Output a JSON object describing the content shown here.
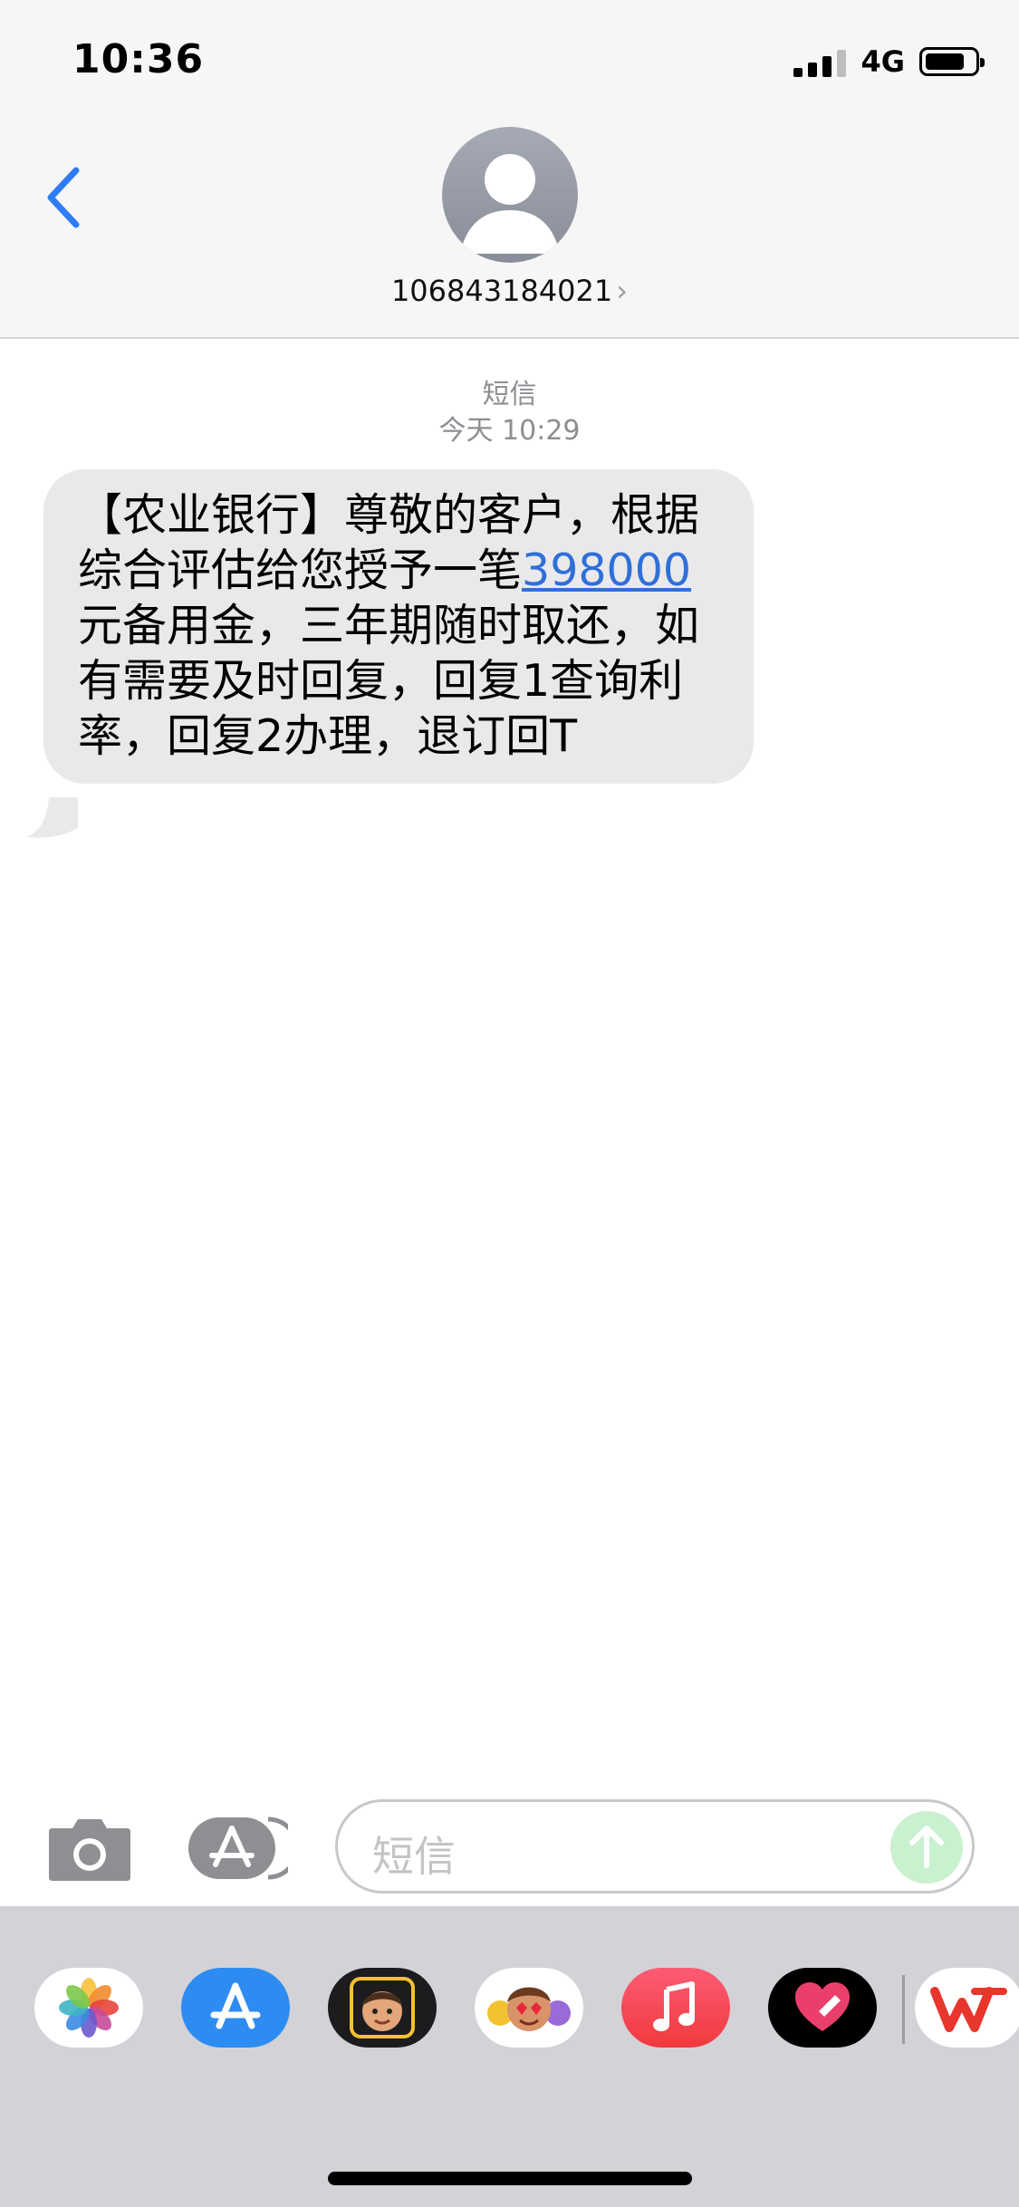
{
  "status_bar": {
    "time": "10:36",
    "network": "4G"
  },
  "header": {
    "contact": "106843184021",
    "contact_chevron": "›",
    "back_icon": "chevron-left-icon",
    "avatar_icon": "person-silhouette-icon"
  },
  "conversation": {
    "service_label": "短信",
    "timestamp": "今天 10:29",
    "message": {
      "before_link": "【农业银行】尊敬的客户，根据综合评估给您授予一笔",
      "link_text": "398000",
      "after_link": "元备用金，三年期随时取还，如有需要及时回复，回复1查询利率，回复2办理，退订回T"
    }
  },
  "compose": {
    "placeholder": "短信",
    "camera_icon": "camera-icon",
    "apps_icon": "app-store-icon",
    "send_icon": "arrow-up-icon"
  },
  "app_drawer": {
    "apps": [
      {
        "name": "photos-icon"
      },
      {
        "name": "app-store-icon"
      },
      {
        "name": "memoji-icon"
      },
      {
        "name": "animoji-stickers-icon"
      },
      {
        "name": "music-icon"
      },
      {
        "name": "digital-touch-icon"
      },
      {
        "name": "wps-office-icon"
      }
    ]
  },
  "colors": {
    "link": "#2f6fd8",
    "ios_blue": "#2f7cf6",
    "bubble": "#e9e9eb",
    "header_bg": "#f6f6f6",
    "drawer_bg": "#d2d2d7"
  }
}
